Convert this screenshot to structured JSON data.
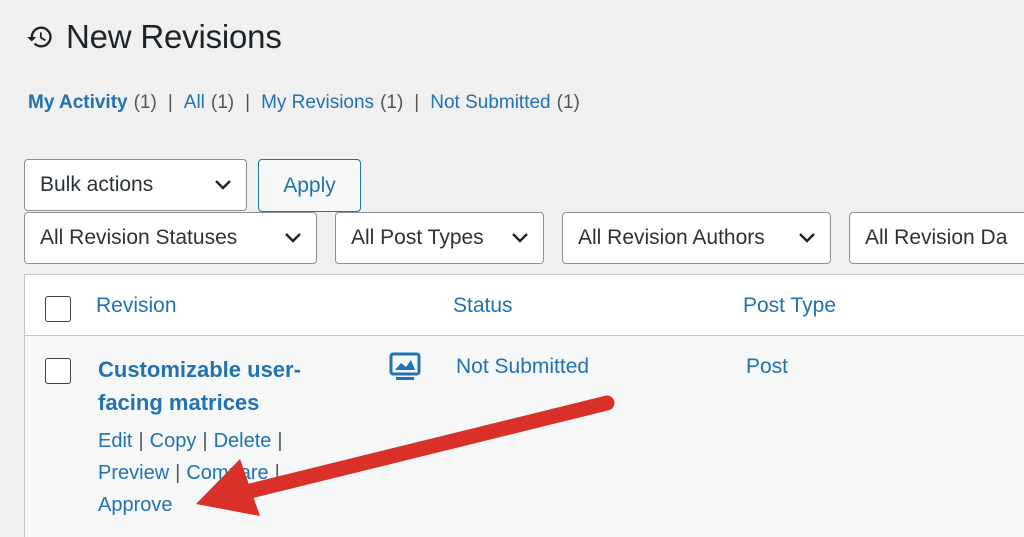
{
  "header": {
    "title": "New Revisions",
    "icon": "history-icon"
  },
  "filters": [
    {
      "label": "My Activity",
      "count": "(1)",
      "current": true
    },
    {
      "label": "All",
      "count": "(1)",
      "current": false
    },
    {
      "label": "My Revisions",
      "count": "(1)",
      "current": false
    },
    {
      "label": "Not Submitted",
      "count": "(1)",
      "current": false
    }
  ],
  "separator": "|",
  "toolbar": {
    "bulk_actions": "Bulk actions",
    "apply_label": "Apply",
    "revision_statuses": "All Revision Statuses",
    "post_types": "All Post Types",
    "revision_authors": "All Revision Authors",
    "revision_dates": "All Revision Da"
  },
  "table": {
    "columns": [
      "Revision",
      "Status",
      "Post Type"
    ],
    "rows": [
      {
        "title": "Customizable user-facing matrices",
        "status": "Not Submitted",
        "post_type": "Post",
        "actions": [
          "Edit",
          "Copy",
          "Delete",
          "Preview",
          "Compare",
          "Approve"
        ]
      }
    ]
  },
  "colors": {
    "accent": "#2271b1",
    "background": "#f0f0f1",
    "annotation_arrow": "#d9302a"
  }
}
